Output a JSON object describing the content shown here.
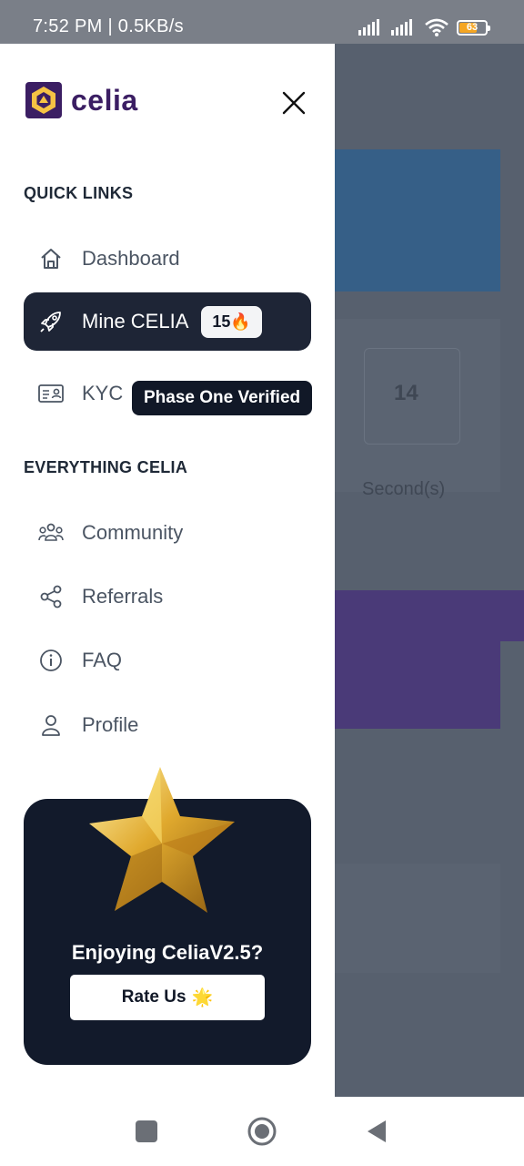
{
  "status_bar": {
    "time": "7:52 PM | 0.5KB/s",
    "battery": "63"
  },
  "drawer": {
    "logo_text": "celia",
    "quick_links_title": "QUICK LINKS",
    "quick_links": [
      {
        "label": "Dashboard",
        "icon": "home-icon"
      },
      {
        "label": "Mine CELIA",
        "icon": "rocket-icon",
        "badge": "15🔥",
        "active": true
      },
      {
        "label": "KYC",
        "icon": "id-card-icon",
        "badge": "Phase One Verified"
      }
    ],
    "everything_title": "EVERYTHING CELIA",
    "everything_links": [
      {
        "label": "Community",
        "icon": "users-icon"
      },
      {
        "label": "Referrals",
        "icon": "share-icon"
      },
      {
        "label": "FAQ",
        "icon": "info-icon"
      },
      {
        "label": "Profile",
        "icon": "user-icon"
      }
    ],
    "rate_card": {
      "title": "Enjoying CeliaV2.5?",
      "button_label": "Rate Us",
      "button_emoji": "🌟"
    }
  },
  "background_app": {
    "stat_value": "14",
    "stat_label": "Second(s)"
  },
  "colors": {
    "brand_purple": "#3b1e63",
    "brand_yellow": "#f6c344",
    "active_bg": "#1e2536",
    "card_bg": "#121a2b"
  }
}
